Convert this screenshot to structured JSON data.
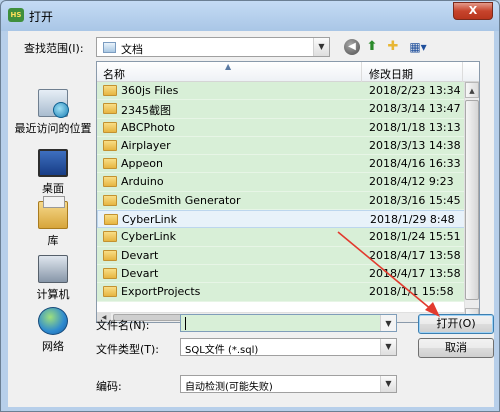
{
  "window": {
    "title": "打开",
    "app_icon": "app-logo-icon"
  },
  "lookin": {
    "label": "查找范围(I):",
    "value": "文档"
  },
  "places": [
    {
      "label": "最近访问的位置",
      "icon": "recent-places-icon"
    },
    {
      "label": "桌面",
      "icon": "desktop-icon"
    },
    {
      "label": "库",
      "icon": "libraries-icon"
    },
    {
      "label": "计算机",
      "icon": "computer-icon"
    },
    {
      "label": "网络",
      "icon": "network-icon"
    }
  ],
  "columns": {
    "name": "名称",
    "date": "修改日期"
  },
  "files": [
    {
      "name": "360js Files",
      "date": "2018/2/23 13:34"
    },
    {
      "name": "2345截图",
      "date": "2018/3/14 13:47"
    },
    {
      "name": "ABCPhoto",
      "date": "2018/1/18 13:13"
    },
    {
      "name": "Airplayer",
      "date": "2018/3/13 14:38"
    },
    {
      "name": "Appeon",
      "date": "2018/4/16 16:33"
    },
    {
      "name": "Arduino",
      "date": "2018/4/12 9:23"
    },
    {
      "name": "CodeSmith Generator",
      "date": "2018/3/16 15:45"
    },
    {
      "name": "CyberLink",
      "date": "2018/1/29 8:48"
    },
    {
      "name": "CyberLink",
      "date": "2018/1/24 15:51"
    },
    {
      "name": "Devart",
      "date": "2018/4/17 13:58"
    },
    {
      "name": "Devart",
      "date": "2018/4/17 13:58"
    },
    {
      "name": "ExportProjects",
      "date": "2018/1/1 15:58"
    }
  ],
  "form": {
    "filename_label": "文件名(N):",
    "filename_value": "",
    "filetype_label": "文件类型(T):",
    "filetype_value": "SQL文件 (*.sql)",
    "encoding_label": "编码:",
    "encoding_value": "自动检测(可能失败)"
  },
  "buttons": {
    "open": "打开(O)",
    "cancel": "取消",
    "close": "X"
  },
  "colors": {
    "row_highlight": "#d8efd7",
    "annotation_arrow": "#e23a2e"
  }
}
